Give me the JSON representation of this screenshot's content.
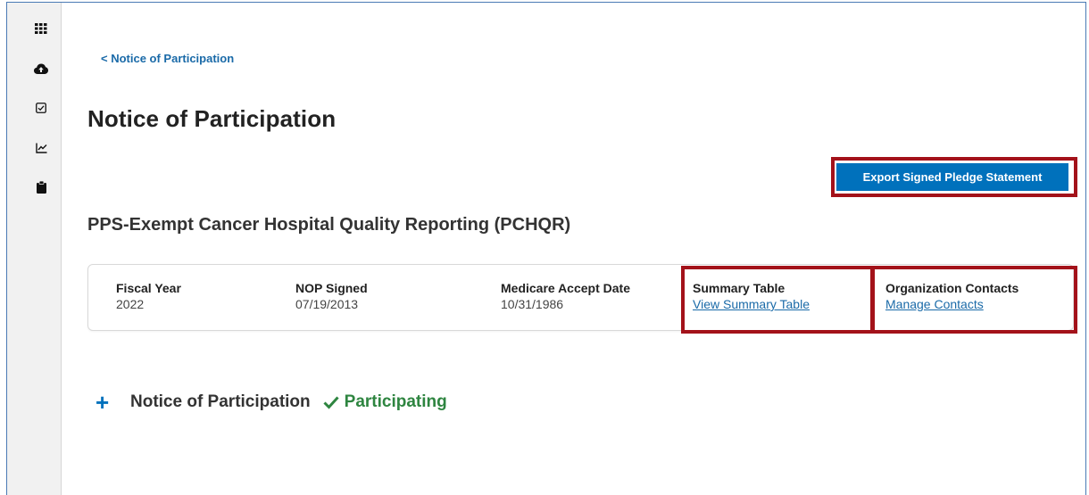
{
  "sidebar": {
    "items": [
      {
        "icon": "grid-icon"
      },
      {
        "icon": "cloud-upload-icon"
      },
      {
        "icon": "checkbox-icon"
      },
      {
        "icon": "chart-icon"
      },
      {
        "icon": "clipboard-icon"
      }
    ]
  },
  "breadcrumb": {
    "label": "< Notice of Participation"
  },
  "page": {
    "title": "Notice of Participation"
  },
  "actions": {
    "export_label": "Export Signed Pledge Statement"
  },
  "program": {
    "title": "PPS-Exempt Cancer Hospital Quality Reporting (PCHQR)"
  },
  "info": {
    "fiscal_year": {
      "label": "Fiscal Year",
      "value": "2022"
    },
    "nop_signed": {
      "label": "NOP Signed",
      "value": "07/19/2013"
    },
    "medicare_accept": {
      "label": "Medicare Accept Date",
      "value": "10/31/1986"
    },
    "summary_table": {
      "label": "Summary Table",
      "link": "View Summary Table"
    },
    "org_contacts": {
      "label": "Organization Contacts",
      "link": "Manage Contacts"
    }
  },
  "nop_section": {
    "toggle": "+",
    "label": "Notice of Participation",
    "status": "Participating"
  },
  "colors": {
    "primary": "#0071bc",
    "link": "#1a6aa8",
    "success": "#2e8540",
    "highlight": "#a3121a"
  }
}
